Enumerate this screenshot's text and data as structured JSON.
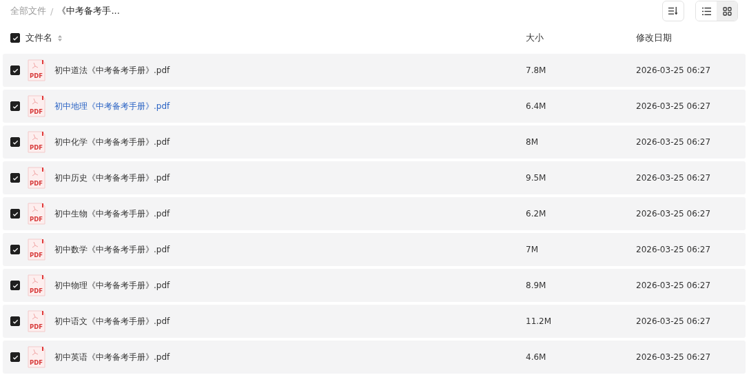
{
  "breadcrumb": {
    "separator": "/",
    "items": [
      {
        "label": "全部文件",
        "current": false
      },
      {
        "label": "《中考备考手...",
        "current": true
      }
    ]
  },
  "toolbar": {
    "view_modes": [
      {
        "kind": "list",
        "selected": false
      },
      {
        "kind": "grid",
        "selected": true
      }
    ]
  },
  "table": {
    "select_all": {
      "checked": true
    },
    "columns": [
      {
        "label": "文件名",
        "sortable": true
      },
      {
        "label": "大小",
        "sortable": false
      },
      {
        "label": "修改日期",
        "sortable": false
      }
    ],
    "rows": [
      {
        "icon_label": "PDF",
        "name": "初中道法《中考备考手册》.pdf",
        "size": "7.8M",
        "modified": "2026-03-25 06:27",
        "checked": true,
        "hovered": false
      },
      {
        "icon_label": "PDF",
        "name": "初中地理《中考备考手册》.pdf",
        "size": "6.4M",
        "modified": "2026-03-25 06:27",
        "checked": true,
        "hovered": true
      },
      {
        "icon_label": "PDF",
        "name": "初中化学《中考备考手册》.pdf",
        "size": "8M",
        "modified": "2026-03-25 06:27",
        "checked": true,
        "hovered": false
      },
      {
        "icon_label": "PDF",
        "name": "初中历史《中考备考手册》.pdf",
        "size": "9.5M",
        "modified": "2026-03-25 06:27",
        "checked": true,
        "hovered": false
      },
      {
        "icon_label": "PDF",
        "name": "初中生物《中考备考手册》.pdf",
        "size": "6.2M",
        "modified": "2026-03-25 06:27",
        "checked": true,
        "hovered": false
      },
      {
        "icon_label": "PDF",
        "name": "初中数学《中考备考手册》.pdf",
        "size": "7M",
        "modified": "2026-03-25 06:27",
        "checked": true,
        "hovered": false
      },
      {
        "icon_label": "PDF",
        "name": "初中物理《中考备考手册》.pdf",
        "size": "8.9M",
        "modified": "2026-03-25 06:27",
        "checked": true,
        "hovered": false
      },
      {
        "icon_label": "PDF",
        "name": "初中语文《中考备考手册》.pdf",
        "size": "11.2M",
        "modified": "2026-03-25 06:27",
        "checked": true,
        "hovered": false
      },
      {
        "icon_label": "PDF",
        "name": "初中英语《中考备考手册》.pdf",
        "size": "4.6M",
        "modified": "2026-03-25 06:27",
        "checked": true,
        "hovered": false
      }
    ]
  }
}
